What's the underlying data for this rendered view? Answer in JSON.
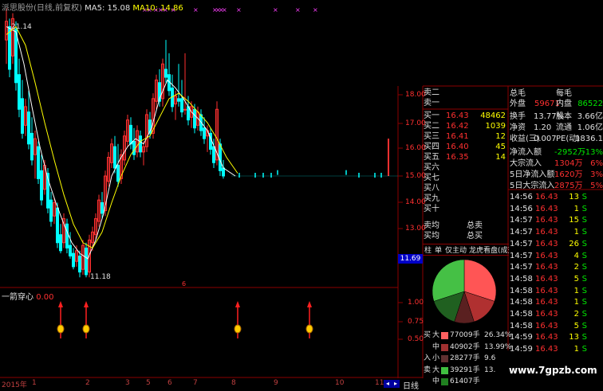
{
  "header": {
    "title": "派思股份(日线,前复权)",
    "ma5_label": "MA5: 15.08",
    "ma10_label": "MA10: 14.86",
    "markers": "××××  ×  ××××  ×  ×  ×"
  },
  "colors": {
    "up": "#ff3030",
    "down": "#00ffff",
    "ma5": "#ffffff",
    "ma10": "#ffff00",
    "grid": "#8b0000",
    "bg": "#000000"
  },
  "price_axis": [
    "18.00",
    "17.00",
    "16.00",
    "15.00",
    "14.00",
    "13.00",
    "12.00"
  ],
  "current_price_tag": "11.69",
  "annotations": {
    "high": "21.14",
    "low": "11.18"
  },
  "indicator": {
    "title": "一箭穿心",
    "value": "0.00",
    "axis": [
      "1.00",
      "0.75",
      "0.50"
    ],
    "signal_count": 4
  },
  "time_axis": [
    "2015年",
    "1",
    "2",
    "3",
    "5",
    "6",
    "7",
    "8",
    "9",
    "10",
    "11"
  ],
  "period_label": "日线",
  "order_book": {
    "sell": [
      {
        "label": "卖二",
        "price": "",
        "vol": ""
      },
      {
        "label": "卖一",
        "price": "",
        "vol": ""
      }
    ],
    "buy": [
      {
        "label": "买一",
        "price": "16.43",
        "vol": "48462"
      },
      {
        "label": "买二",
        "price": "16.42",
        "vol": "1039"
      },
      {
        "label": "买三",
        "price": "16.41",
        "vol": "12"
      },
      {
        "label": "买四",
        "price": "16.40",
        "vol": "45"
      },
      {
        "label": "买五",
        "price": "16.35",
        "vol": "14"
      },
      {
        "label": "买六",
        "price": "",
        "vol": ""
      },
      {
        "label": "买七",
        "price": "",
        "vol": ""
      },
      {
        "label": "买八",
        "price": "",
        "vol": ""
      },
      {
        "label": "买九",
        "price": "",
        "vol": ""
      },
      {
        "label": "买十",
        "price": "",
        "vol": ""
      }
    ],
    "avg_sell": "卖均",
    "total_sell": "总卖",
    "avg_buy": "买均",
    "total_buy": "总买"
  },
  "tabs": [
    "柱",
    "单",
    "仅主动",
    "龙虎看盘(成交量)"
  ],
  "stats": {
    "top": {
      "a": "总毛",
      "b": "每毛"
    },
    "outer_label": "外盘",
    "outer": "59671",
    "inner_label": "内盘",
    "inner": "86522",
    "rows": [
      {
        "l1": "换手",
        "v1": "13.77%",
        "l2": "股本",
        "v2": "3.66亿"
      },
      {
        "l1": "净资",
        "v1": "1.20",
        "l2": "流通",
        "v2": "1.06亿"
      },
      {
        "l1": "收益(三)",
        "v1": "0.007",
        "l2": "PE(动)",
        "v2": "1836.1"
      }
    ],
    "flows": [
      {
        "label": "净流入额",
        "v": "-2952万",
        "p": "-13%"
      },
      {
        "label": "大宗流入",
        "v": "1304万",
        "p": "6%"
      },
      {
        "label": "5日净流入额",
        "v": "1620万",
        "p": "3%"
      },
      {
        "label": "5日大宗流入",
        "v": "2875万",
        "p": "5%"
      }
    ]
  },
  "ticks": [
    {
      "t": "14:56",
      "p": "16.43",
      "v": "13",
      "s": "S"
    },
    {
      "t": "14:56",
      "p": "16.43",
      "v": "1",
      "s": "S"
    },
    {
      "t": "14:57",
      "p": "16.43",
      "v": "15",
      "s": "S"
    },
    {
      "t": "14:57",
      "p": "16.43",
      "v": "1",
      "s": "S"
    },
    {
      "t": "14:57",
      "p": "16.43",
      "v": "26",
      "s": "S"
    },
    {
      "t": "14:57",
      "p": "16.43",
      "v": "4",
      "s": "S"
    },
    {
      "t": "14:57",
      "p": "16.43",
      "v": "2",
      "s": "S"
    },
    {
      "t": "14:58",
      "p": "16.43",
      "v": "5",
      "s": "S"
    },
    {
      "t": "14:58",
      "p": "16.43",
      "v": "1",
      "s": "S"
    },
    {
      "t": "14:58",
      "p": "16.43",
      "v": "1",
      "s": "S"
    },
    {
      "t": "14:58",
      "p": "16.43",
      "v": "2",
      "s": "S"
    },
    {
      "t": "14:58",
      "p": "16.43",
      "v": "5",
      "s": "S"
    },
    {
      "t": "14:59",
      "p": "16.43",
      "v": "13",
      "s": "S"
    },
    {
      "t": "14:59",
      "p": "16.43",
      "v": "1",
      "s": "S"
    }
  ],
  "capital": [
    {
      "side": "买",
      "size": "大",
      "vol": "77009手",
      "pct": "26.34%",
      "color": "#ff6060"
    },
    {
      "side": "",
      "size": "中",
      "vol": "40902手",
      "pct": "13.99%",
      "color": "#a03030"
    },
    {
      "side": "入",
      "size": "小",
      "vol": "28277手",
      "pct": "9.6",
      "color": "#603030"
    },
    {
      "side": "卖",
      "size": "大",
      "vol": "39291手",
      "pct": "13.",
      "color": "#40c040"
    },
    {
      "side": "",
      "size": "中",
      "vol": "61407手",
      "pct": "",
      "color": "#208020"
    }
  ],
  "watermark": "www.7gpzb.com"
}
